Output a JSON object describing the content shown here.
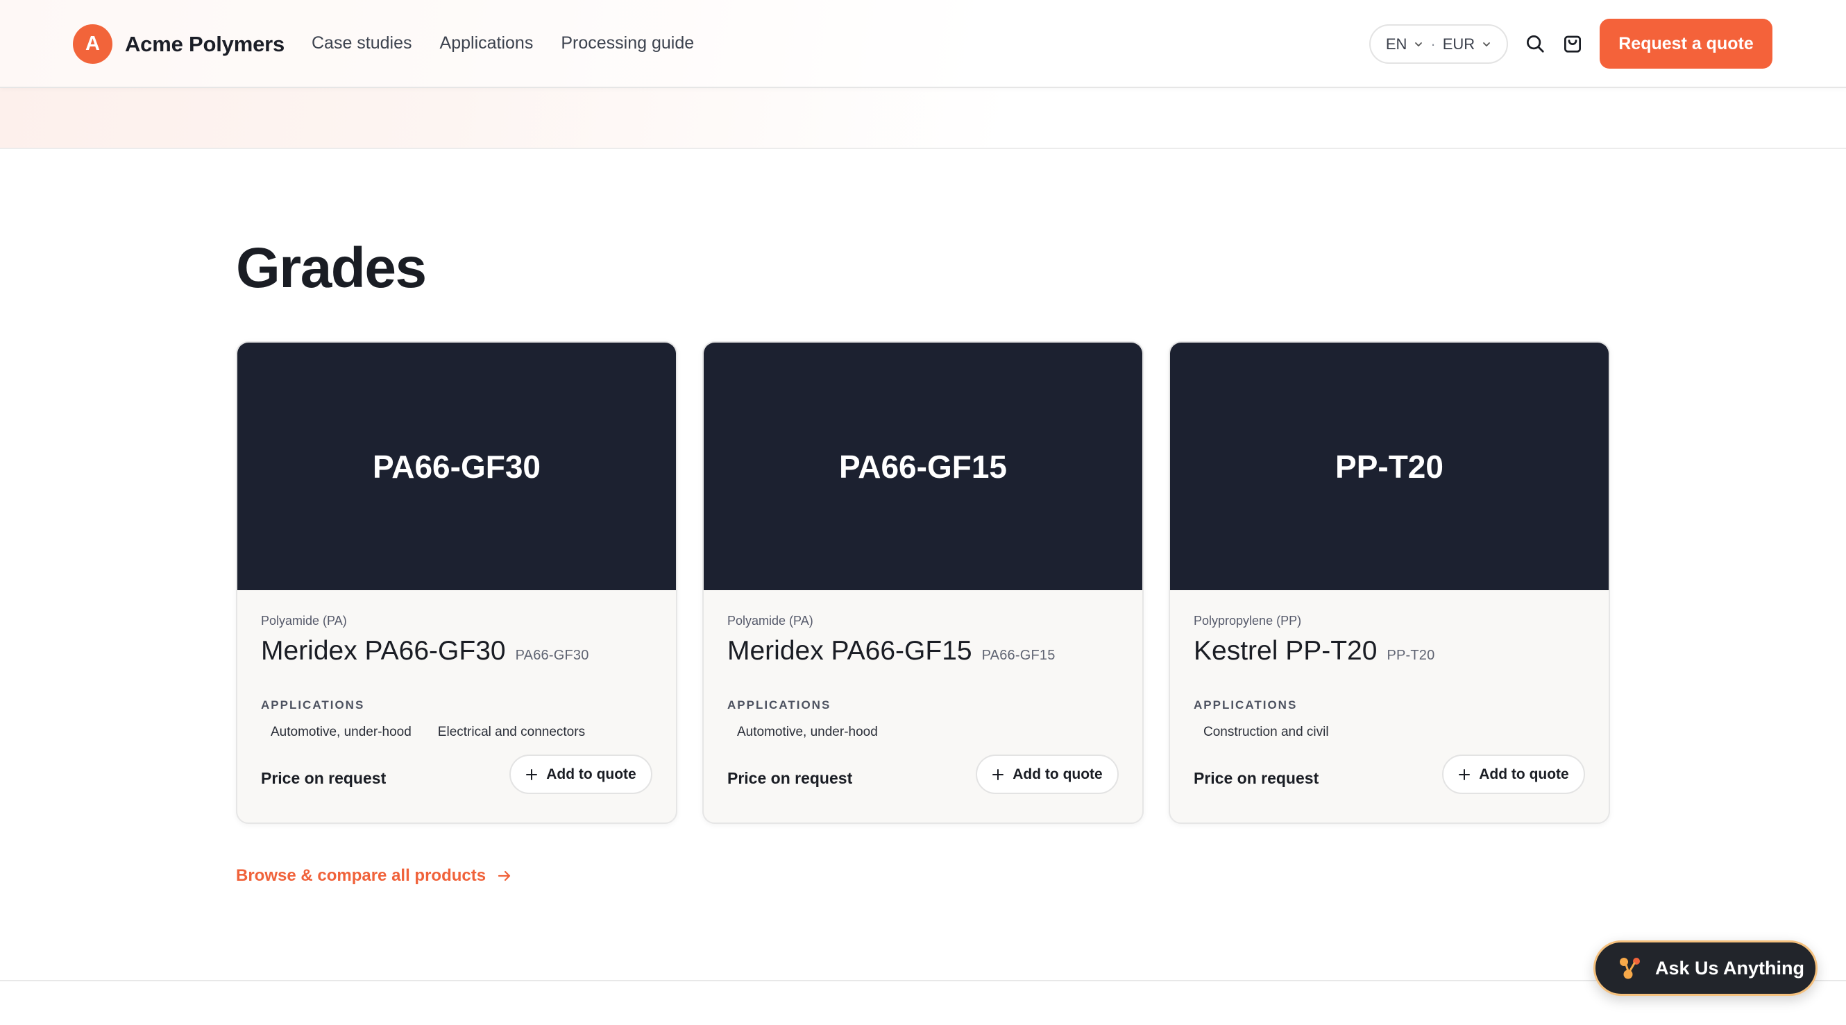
{
  "brand": {
    "logo_letter": "A",
    "name": "Acme Polymers",
    "accent": "#f4623a"
  },
  "nav": {
    "items": [
      "Case studies",
      "Applications",
      "Processing guide"
    ]
  },
  "locale": {
    "language": "EN",
    "separator": "·",
    "currency": "EUR"
  },
  "header_icons": [
    "search-icon",
    "cart-icon"
  ],
  "header": {
    "cta_label": "Request a quote"
  },
  "section": {
    "title": "Grades"
  },
  "cards": [
    {
      "media_label": "PA66-GF30",
      "family": "Polyamide (PA)",
      "name": "Meridex PA66-GF30",
      "code": "PA66-GF30",
      "applications_heading": "APPLICATIONS",
      "applications": [
        "Automotive, under-hood",
        "Electrical and connectors"
      ],
      "price": "Price on request",
      "add_label": "Add to quote"
    },
    {
      "media_label": "PA66-GF15",
      "family": "Polyamide (PA)",
      "name": "Meridex PA66-GF15",
      "code": "PA66-GF15",
      "applications_heading": "APPLICATIONS",
      "applications": [
        "Automotive, under-hood"
      ],
      "price": "Price on request",
      "add_label": "Add to quote"
    },
    {
      "media_label": "PP-T20",
      "family": "Polypropylene (PP)",
      "name": "Kestrel PP-T20",
      "code": "PP-T20",
      "applications_heading": "APPLICATIONS",
      "applications": [
        "Construction and civil"
      ],
      "price": "Price on request",
      "add_label": "Add to quote"
    }
  ],
  "browse_link": {
    "label": "Browse & compare all products",
    "icon": "arrow-right-icon"
  },
  "chat_widget": {
    "label": "Ask Us Anything",
    "icon": "sparkle-dots-icon"
  }
}
